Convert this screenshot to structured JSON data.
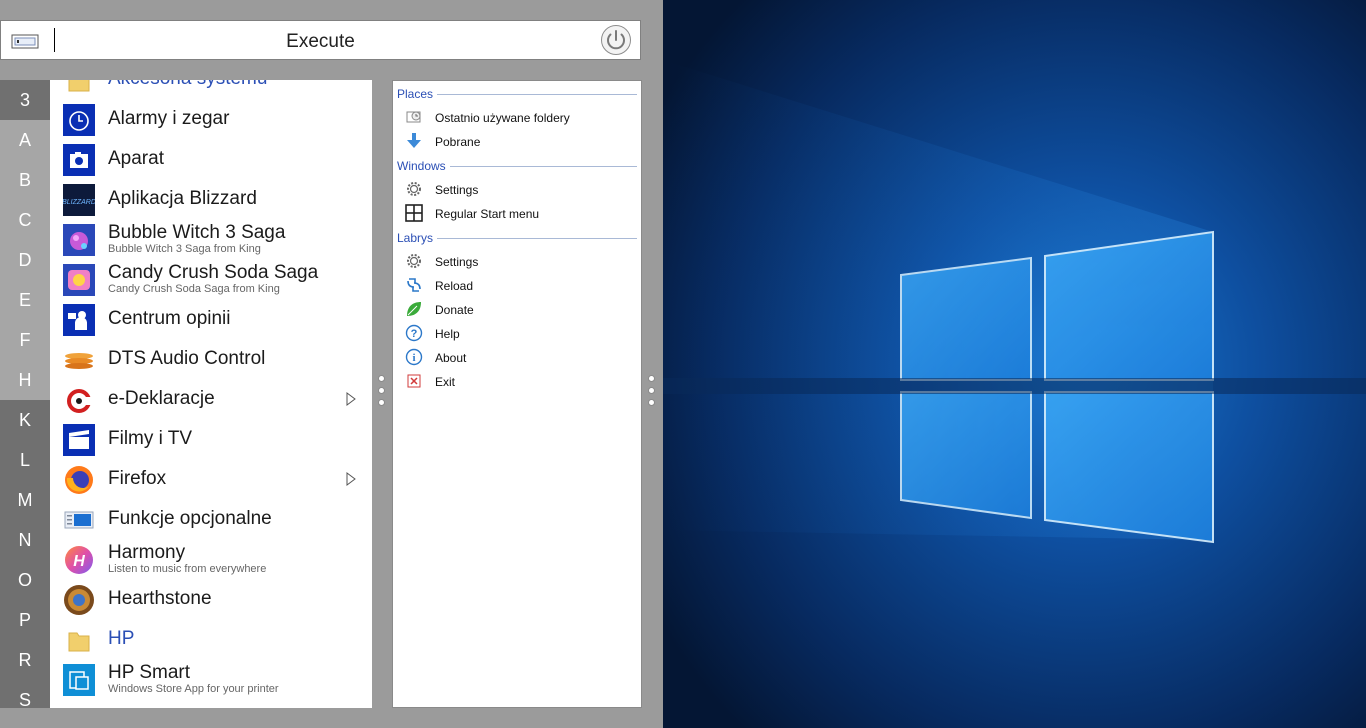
{
  "execute_bar": {
    "title": "Execute"
  },
  "letter_index": {
    "letters": [
      "3",
      "A",
      "B",
      "C",
      "D",
      "E",
      "F",
      "H",
      "K",
      "L",
      "M",
      "N",
      "O",
      "P",
      "R",
      "S"
    ]
  },
  "apps": [
    {
      "name": "Akcesoria systemu",
      "icon": "folder-icon",
      "folder": true
    },
    {
      "name": "Alarmy i zegar",
      "icon": "alarm-clock-icon"
    },
    {
      "name": "Aparat",
      "icon": "camera-icon"
    },
    {
      "name": "Aplikacja Blizzard",
      "icon": "blizzard-icon"
    },
    {
      "name": "Bubble Witch 3 Saga",
      "sub": "Bubble Witch 3 Saga from King",
      "icon": "bubble-witch-icon"
    },
    {
      "name": "Candy Crush Soda Saga",
      "sub": "Candy Crush Soda Saga from King",
      "icon": "candy-crush-icon"
    },
    {
      "name": "Centrum opinii",
      "icon": "feedback-hub-icon"
    },
    {
      "name": "DTS Audio Control",
      "icon": "dts-audio-icon"
    },
    {
      "name": "e-Deklaracje",
      "icon": "e-deklaracje-icon",
      "submenu": true
    },
    {
      "name": "Filmy i TV",
      "icon": "movies-tv-icon"
    },
    {
      "name": "Firefox",
      "icon": "firefox-icon",
      "submenu": true
    },
    {
      "name": "Funkcje opcjonalne",
      "icon": "optional-features-icon"
    },
    {
      "name": "Harmony",
      "sub": "Listen to music from everywhere",
      "icon": "harmony-icon"
    },
    {
      "name": "Hearthstone",
      "icon": "hearthstone-icon"
    },
    {
      "name": "HP",
      "icon": "folder-icon",
      "folder": true
    },
    {
      "name": "HP Smart",
      "sub": "Windows Store App for your printer",
      "icon": "hp-smart-icon"
    }
  ],
  "right_pane": {
    "places": {
      "heading": "Places",
      "items": [
        {
          "label": "Ostatnio używane foldery",
          "icon": "recent-folders-icon"
        },
        {
          "label": "Pobrane",
          "icon": "download-icon"
        }
      ]
    },
    "windows": {
      "heading": "Windows",
      "items": [
        {
          "label": "Settings",
          "icon": "gear-icon"
        },
        {
          "label": "Regular Start menu",
          "icon": "windows-start-icon"
        }
      ]
    },
    "labrys": {
      "heading": "Labrys",
      "items": [
        {
          "label": "Settings",
          "icon": "gear-icon"
        },
        {
          "label": "Reload",
          "icon": "reload-icon"
        },
        {
          "label": "Donate",
          "icon": "leaf-icon"
        },
        {
          "label": "Help",
          "icon": "help-icon"
        },
        {
          "label": "About",
          "icon": "info-icon"
        },
        {
          "label": "Exit",
          "icon": "exit-icon"
        }
      ]
    }
  },
  "colors": {
    "panel_bg": "#9b9b9b",
    "letter_dark": "#707070",
    "letter_light": "#a6a6a6",
    "section_heading": "#2b4fb5",
    "desktop_bg": "#0a1a33",
    "desktop_glow": "#1b8fe6"
  }
}
